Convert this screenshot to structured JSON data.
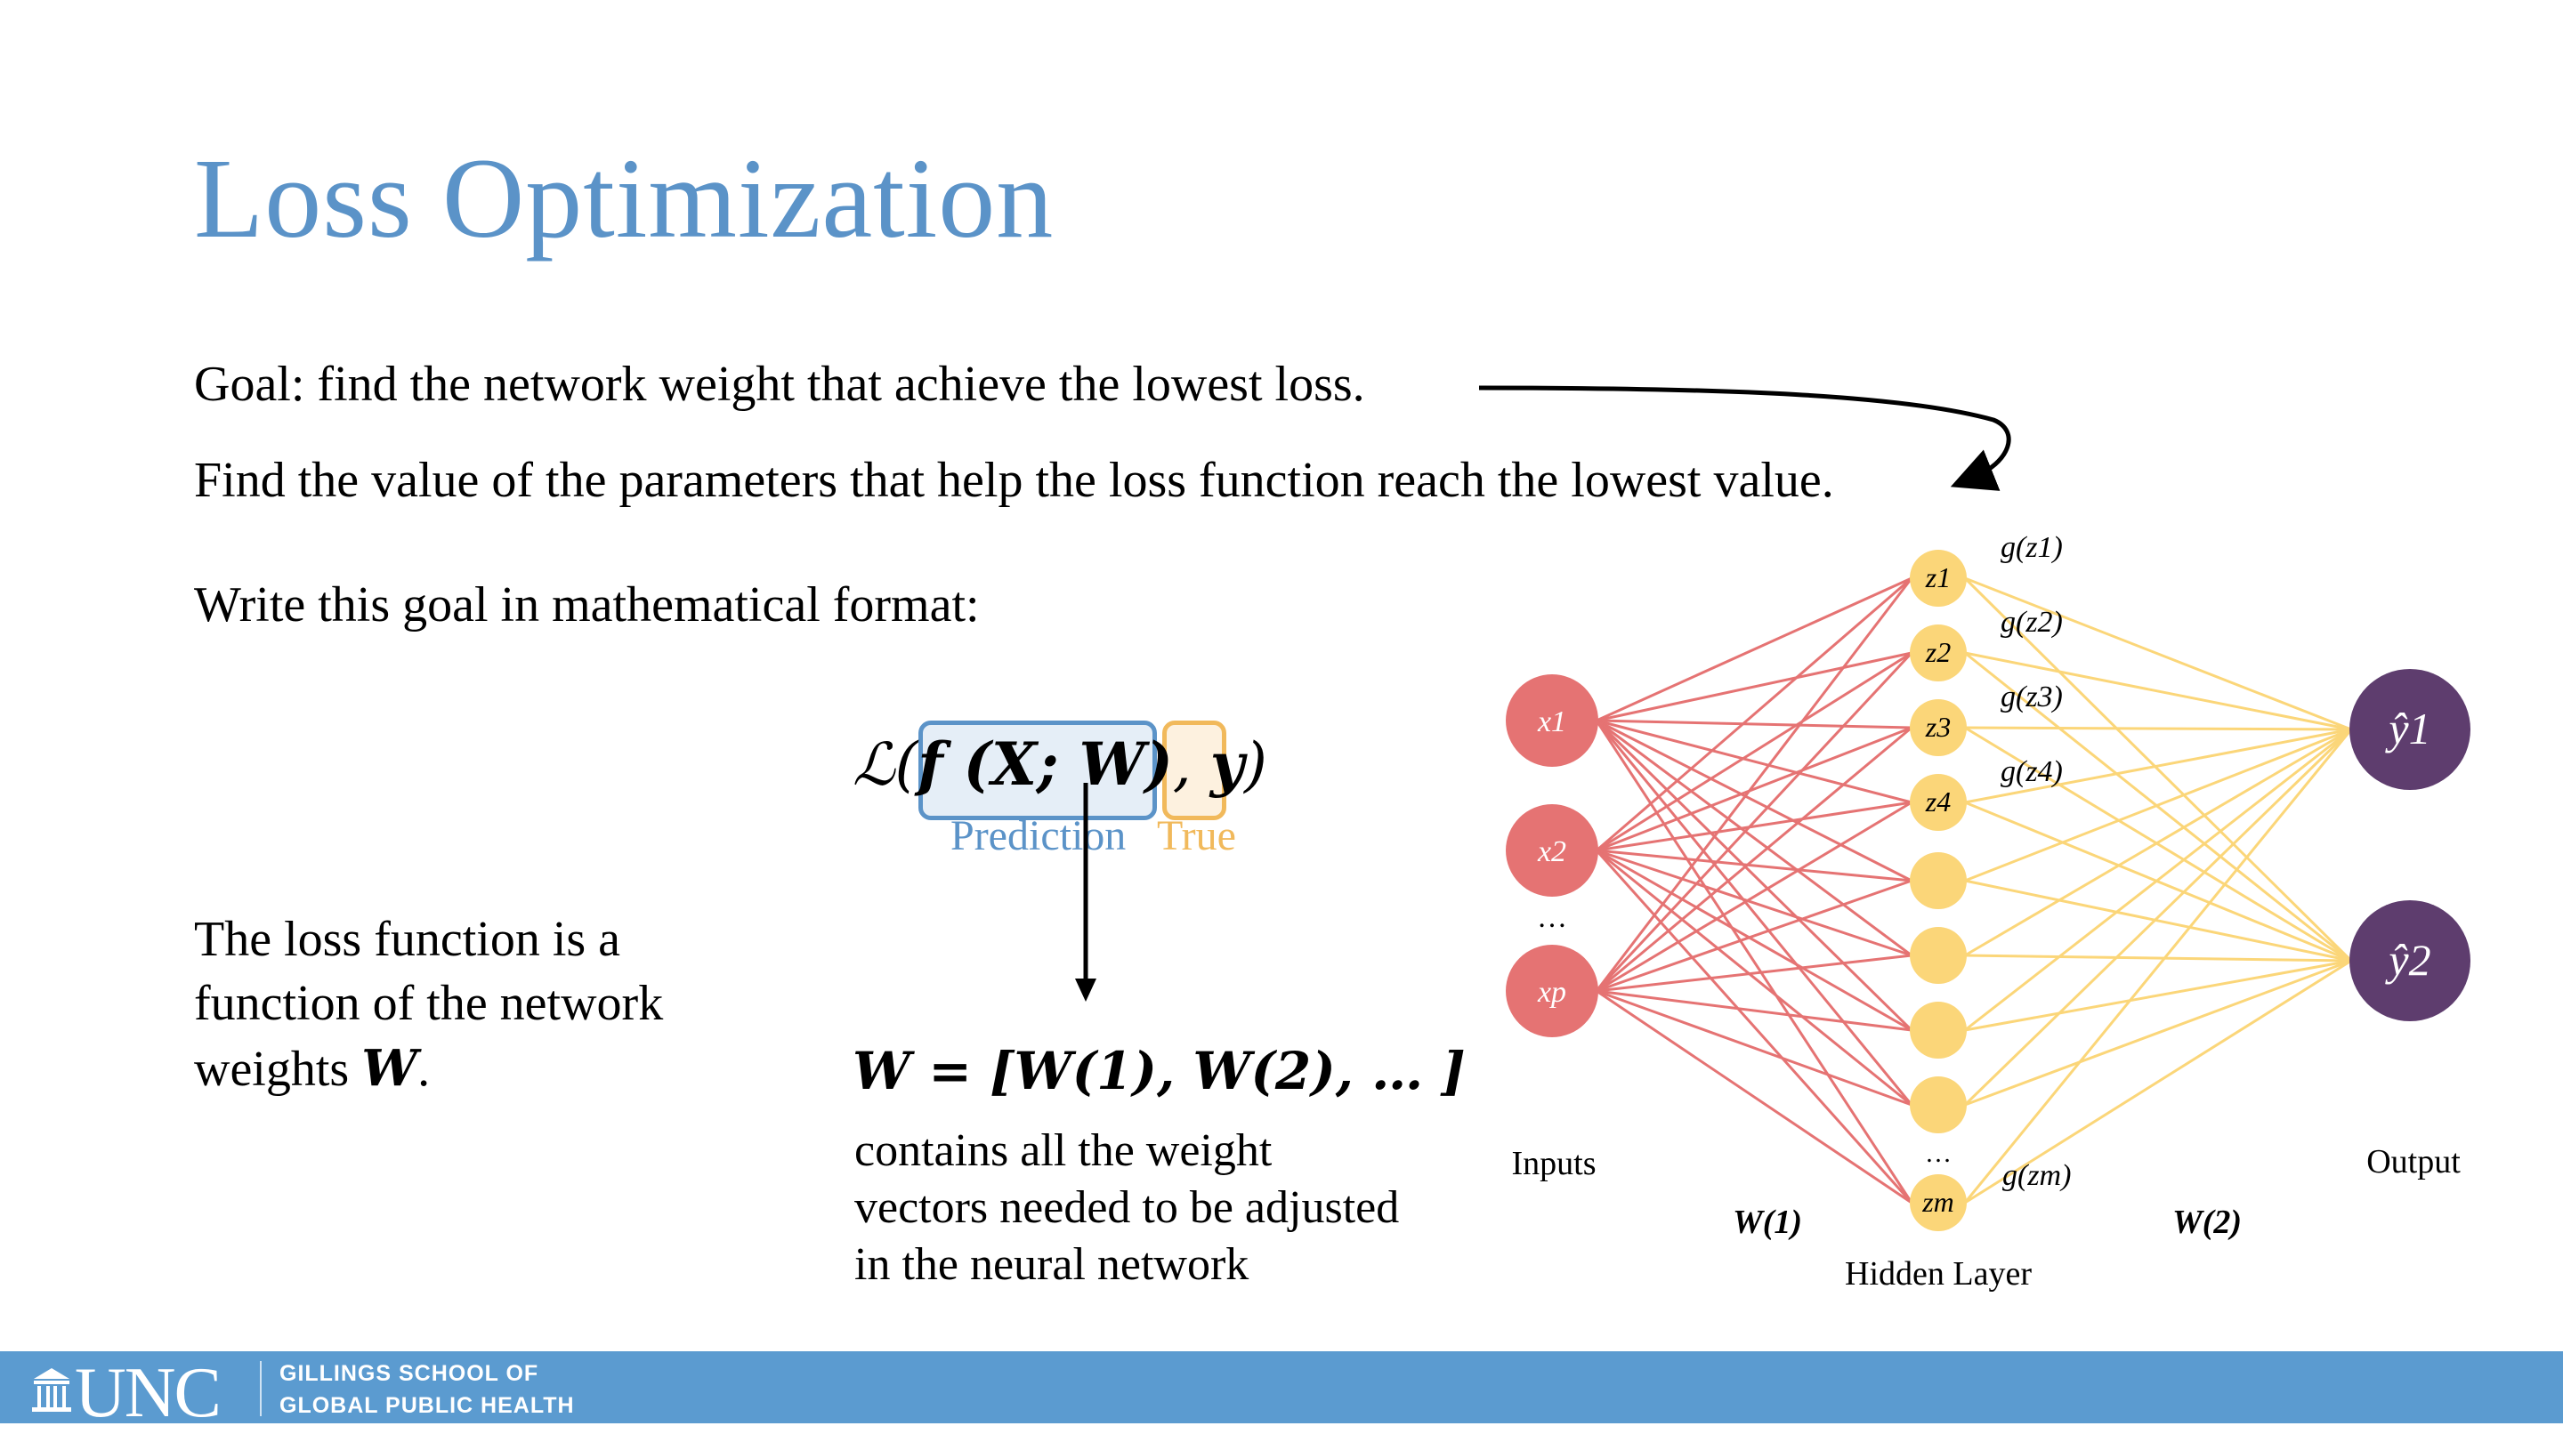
{
  "slide": {
    "title": "Loss Optimization",
    "goal_line": "Goal: find the network weight that achieve the lowest loss.",
    "find_line": "Find the value of the parameters that help the loss function reach the lowest value.",
    "write_line": "Write this goal in mathematical format:",
    "loss_text": [
      "The loss function is a",
      "function of the network"
    ],
    "loss_text_last": "weights",
    "loss_text_weight_symbol": "W",
    "loss_text_period": "."
  },
  "formula": {
    "loss_open": "ℒ(",
    "prediction_expr": "f (X; W)",
    "comma": ",",
    "true_expr": "y",
    "loss_close": ")",
    "prediction_label": "Prediction",
    "true_label": "True",
    "weights_expr": "W = [W(1), W(2), … ]",
    "weights_caption": [
      "contains all the weight",
      "vectors needed to be adjusted",
      "in the neural network"
    ]
  },
  "network": {
    "inputs": [
      "x1",
      "x2",
      "xp"
    ],
    "input_ellipsis": "…",
    "hidden_labeled": [
      "z1",
      "z2",
      "z3",
      "z4"
    ],
    "hidden_unlabeled_count": 4,
    "hidden_last": "zm",
    "hidden_ellipsis": "…",
    "activations": [
      "g(z1)",
      "g(z2)",
      "g(z3)",
      "g(z4)",
      "g(zm)"
    ],
    "outputs": [
      "ŷ1",
      "ŷ2"
    ],
    "inputs_label": "Inputs",
    "hidden_label": "Hidden Layer",
    "output_label": "Output",
    "w1_label": "W(1)",
    "w2_label": "W(2)"
  },
  "footer": {
    "logo": "UNC",
    "line1": "GILLINGS SCHOOL OF",
    "line2": "GLOBAL PUBLIC HEALTH"
  },
  "colors": {
    "title": "#5b93c8",
    "input_node": "#e57373",
    "hidden_node": "#fbd679",
    "output_node": "#5e3d6e",
    "prediction_box": "#5b93c8",
    "true_box": "#f1b95b",
    "footer": "#5b9bd0"
  }
}
